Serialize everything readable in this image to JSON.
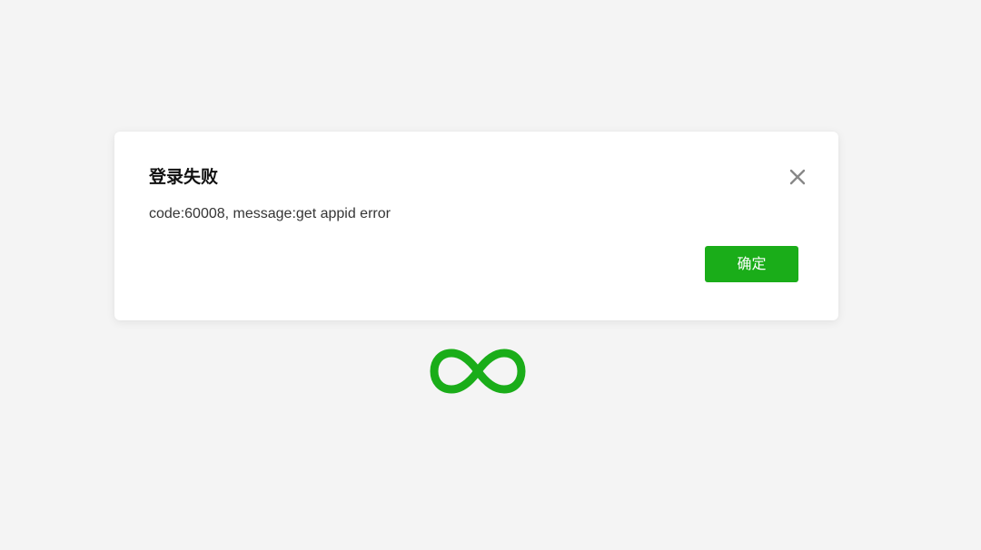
{
  "dialog": {
    "title": "登录失败",
    "message": "code:60008, message:get appid error",
    "confirm_label": "确定",
    "close_icon": "close-icon"
  },
  "loading": {
    "icon": "infinity-loading-icon"
  },
  "colors": {
    "background": "#f4f4f4",
    "dialog_background": "#ffffff",
    "accent_green": "#1aad19",
    "close_icon": "#888888"
  }
}
